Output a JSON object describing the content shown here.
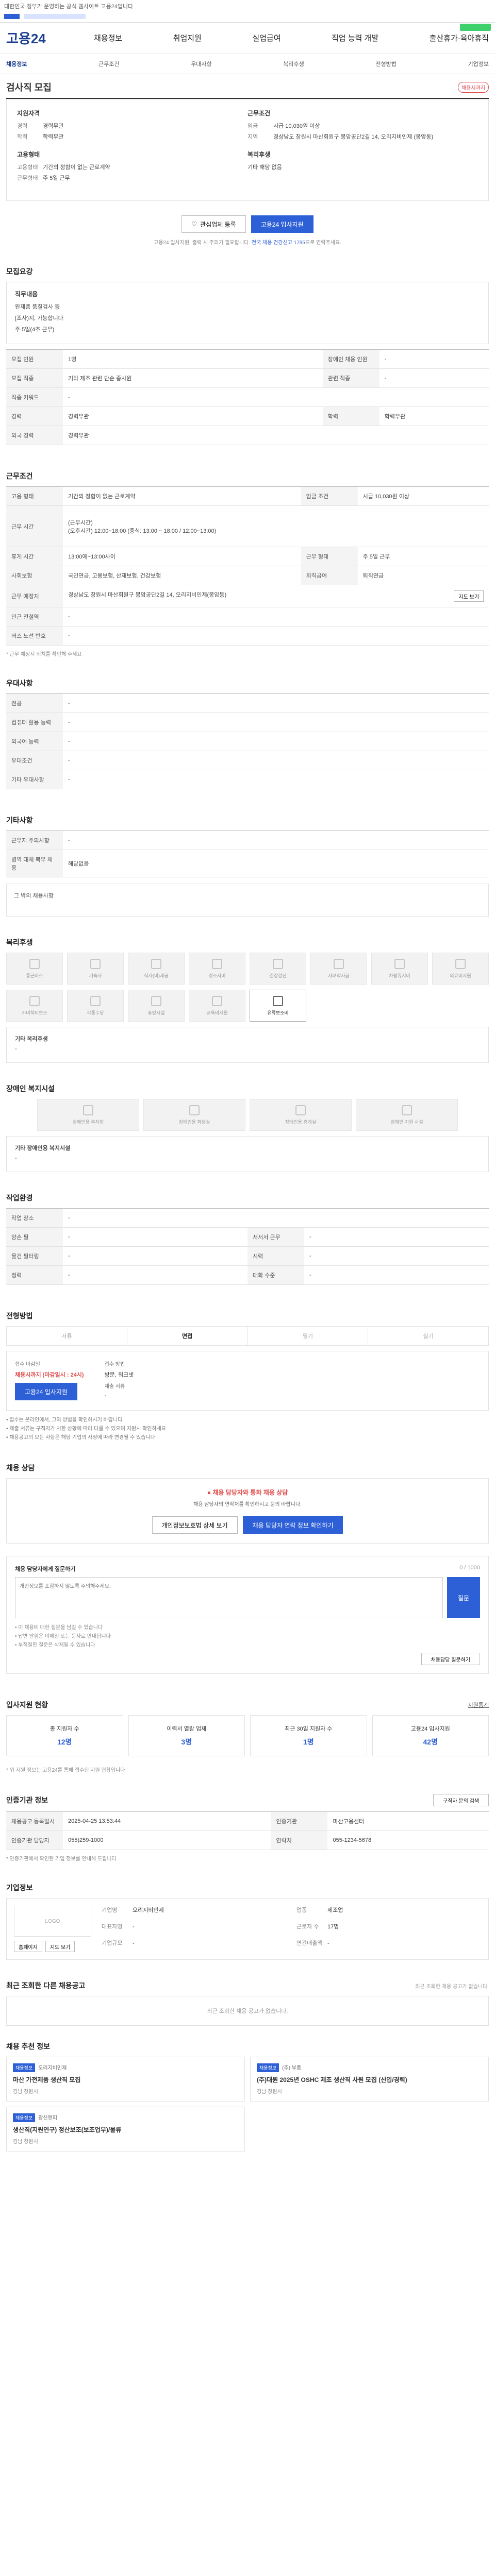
{
  "top_note": "대한민국 정부가 운영하는 공식 웹사이트 고용24입니다",
  "brand": "고용24",
  "nav": [
    "채용정보",
    "취업지원",
    "실업급여",
    "직업 능력 개발",
    "출산휴가·육아휴직"
  ],
  "subnav": [
    "채용정보",
    "근무조건",
    "우대사항",
    "복리후생",
    "전형방법",
    "기업정보"
  ],
  "title": "검사직 모집",
  "title_badge": "채용시까지",
  "summary": {
    "apply_title": "지원자격",
    "apply_items": [
      {
        "k": "경력",
        "v": "경력무관"
      },
      {
        "k": "학력",
        "v": "학력무관"
      }
    ],
    "work_title": "근무조건",
    "work_items": [
      {
        "k": "임금",
        "v": "시급 10,030원 이상"
      },
      {
        "k": "지역",
        "v": "경상남도 창원시 마산회원구 봉암공단2길 14, 오리지비인제 (봉암동)"
      }
    ],
    "emp_title": "고용형태",
    "emp_items": [
      {
        "k": "고용형태",
        "v": "기간의 정함이 없는 근로계약"
      },
      {
        "k": "근무형태",
        "v": "주 5일 근무"
      }
    ],
    "welfare_title": "복리후생",
    "welfare_items": [
      {
        "k": "",
        "v": "기타 해당 없음"
      }
    ]
  },
  "actions": {
    "scrap": "관심업체 등록",
    "apply": "고용24 입사지원"
  },
  "actions_note_a": "고용24 입사지원, 출력 시 주의가 필요합니다.",
  "actions_note_b": "전국 채용 건강신고 1795",
  "actions_note_c": "으로 연락주세요.",
  "sec_require": "모집요강",
  "job_box": {
    "title": "직무내용",
    "lines": [
      "완제품 품질검사 등",
      "[조사)지, 가능합니다",
      "주 5일(4조 근무)"
    ]
  },
  "require_rows": [
    [
      "모집 인원",
      "1명",
      "장애인 채용 인원",
      "-"
    ],
    [
      "모집 직종",
      "기타 제조 관련 단순 종사원",
      "관련 직종",
      "-"
    ],
    [
      "직종 키워드",
      "-",
      "",
      ""
    ],
    [
      "경력",
      "경력무관",
      "학력",
      "학력무관"
    ],
    [
      "외국 경력",
      "경력무관",
      "",
      ""
    ]
  ],
  "sec_work": "근무조건",
  "work_rows": [
    [
      "고용 형태",
      "기간의 정함이 없는 근로계약",
      "임금 조건",
      "시급 10,030원 이상"
    ],
    [
      "근무 시간",
      "(근무시간)\n(오후시간) 12:00~18:00 (중식: 13:00 ~ 18:00 / 12:00~13:00)",
      "",
      ""
    ],
    [
      "휴게 시간",
      "13:00에~13:00사이",
      "근무 형태",
      "주 5일 근무"
    ],
    [
      "사회보험",
      "국민연금, 고용보험, 산재보험, 건강보험",
      "퇴직급여",
      "퇴직연금"
    ],
    [
      "근무 예정지",
      "경상남도 창원시 마산회원구 봉암공단2길 14, 오리지비인제(봉암동)",
      "",
      ""
    ],
    [
      "인근 전철역",
      "-",
      "",
      ""
    ],
    [
      "버스 노선 번호",
      "-",
      "",
      ""
    ]
  ],
  "work_map_btn": "지도 보기",
  "work_note": "* 근무 예정지 위치를 확인해 주세요",
  "sec_pref": "우대사항",
  "pref_rows": [
    [
      "전공",
      "-"
    ],
    [
      "컴퓨터 활용 능력",
      "-"
    ],
    [
      "외국어 능력",
      "-"
    ],
    [
      "우대조건",
      "-"
    ],
    [
      "기타 우대사항",
      "-"
    ]
  ],
  "sec_etc": "기타사항",
  "etc_rows": [
    [
      "근무지 주의사항",
      "-"
    ],
    [
      "병역 대체 복무 채용",
      "해당없음"
    ]
  ],
  "etc_box_title": "그 밖의 채용사항",
  "sec_welfare": "복리후생",
  "welfare_tiles": [
    "통근버스",
    "기숙사",
    "식사(비)제공",
    "경조사비",
    "건강검진",
    "자녀학자금",
    "차량유지비",
    "의료비지원",
    "자녀학비보조",
    "각종수당",
    "휴양시설",
    "교육비지원",
    "유류보조비"
  ],
  "welfare_active_index": 12,
  "welfare_etc_title": "기타 복리후생",
  "welfare_etc_value": "-",
  "sec_disabled": "장애인 복지시설",
  "disabled_tiles": [
    "장애인용 주차장",
    "장애인용 화장실",
    "장애인용 휴게실",
    "장애인 지원 시설"
  ],
  "disabled_etc_title": "기타 장애인용 복지시설",
  "disabled_etc_value": "-",
  "sec_job_env": "작업환경",
  "env_rows": [
    [
      "작업 장소",
      "-",
      "",
      ""
    ],
    [
      "양손 필",
      "-",
      "서서서 근무",
      "-"
    ],
    [
      "물건 필터링",
      "-",
      "시력",
      "-"
    ],
    [
      "청력",
      "-",
      "대화 수준",
      "-"
    ]
  ],
  "sec_select": "전형방법",
  "select_steps": [
    "서류",
    "면접",
    "필기",
    "실기"
  ],
  "select_active": 1,
  "apply_info": {
    "deadline_label": "접수 마감일",
    "deadline_value": "채용시까지 (마감일시 : 24시)",
    "method_label": "접수 방법",
    "method_value": "방문, 워크넷",
    "docs_label": "제출 서류",
    "docs_value": "-",
    "btn": "고용24 입사지원"
  },
  "apply_notes": [
    "• 접수는 온라인에서, 그외 방법을 확인하시기 바랍니다",
    "• 제출 서류는 구직자가 처한 상황에 따라 다를 수 있으며 지원시 확인하세요",
    "• 채용공고의 모든 사항은 해당 기업의 사정에 따라 변경될 수 있습니다"
  ],
  "sec_warn": "채용 상담",
  "warn": {
    "title": "채용 담당자와 통화 채용 상담",
    "desc": "채용 담당자의 연락처를 확인하시고 문의 바랍니다.",
    "btn1": "개인정보보호법 상세 보기",
    "btn2": "채용 담당자 연락 정보 확인하기"
  },
  "inquiry": {
    "title": "채용 담당자에게 질문하기",
    "counter": "0 / 1000",
    "placeholder": "개인정보를 포함하지 않도록 주의해주세요.",
    "btn": "질문",
    "notes": [
      "• 이 채용에 대한 질문을 남길 수 있습니다",
      "• 답변 알림은 이메일 또는 문자로 안내됩니다",
      "• 부적절한 질문은 삭제될 수 있습니다"
    ],
    "more_btn": "채용담당 질문하기"
  },
  "sec_status": "입사지원 현황",
  "status_link": "지원통계",
  "stats": [
    {
      "label": "총 지원자 수",
      "value": "12명"
    },
    {
      "label": "이력서 열람 업체",
      "value": "3명"
    },
    {
      "label": "최근 30일 지원자 수",
      "value": "1명"
    },
    {
      "label": "고용24 입사지원",
      "value": "42명"
    }
  ],
  "status_note": "* 위 지원 정보는 고용24를 통해 접수된 지원 현황입니다",
  "sec_info": "인증기관 정보",
  "info_btn": "구직자 문의 검색",
  "info_rows": [
    [
      "채용공고 등록일시",
      "2025-04-25 13:53:44",
      "인증기관",
      "마산고용센터"
    ],
    [
      "인증기관 담당자",
      "055)259-1000",
      "연락처",
      "055-1234-5678"
    ]
  ],
  "info_note": "* 인증기관에서 확인한 기업 정보를 안내해 드립니다",
  "sec_company": "기업정보",
  "company": {
    "logo": "LOGO",
    "rows": [
      {
        "k": "기업명",
        "v": "오리지비인제"
      },
      {
        "k": "업종",
        "v": "제조업"
      },
      {
        "k": "대표자명",
        "v": "-"
      },
      {
        "k": "근로자 수",
        "v": "17명"
      },
      {
        "k": "기업규모",
        "v": "-"
      },
      {
        "k": "연간매출액",
        "v": "-"
      }
    ],
    "btn1": "홈페이지",
    "btn2": "지도 보기"
  },
  "sec_recent": "최근 조회한 다른 채용공고",
  "recent_empty": "최근 조회한 채용 공고가 없습니다.",
  "recent_note": "최근 조회한 채용 공고가 없습니다.",
  "sec_recommend": "채용 추천 정보",
  "recommend": [
    {
      "tag": "채용정보",
      "company": "오리지비인제",
      "title": "마산 가전제품 생산직 모집",
      "meta": "경남 창원시"
    },
    {
      "tag": "채용정보",
      "company": "(주) 부품",
      "title": "(주)대원 2025년 OSHC 제조 생산직 사원 모집 (신입/경력)",
      "meta": "경남 창원시"
    },
    {
      "tag": "채용정보",
      "company": "광신앤피",
      "title": "생산직(지원연구) 정산보조(보조업무)/물류",
      "meta": "경남 창원시"
    }
  ]
}
